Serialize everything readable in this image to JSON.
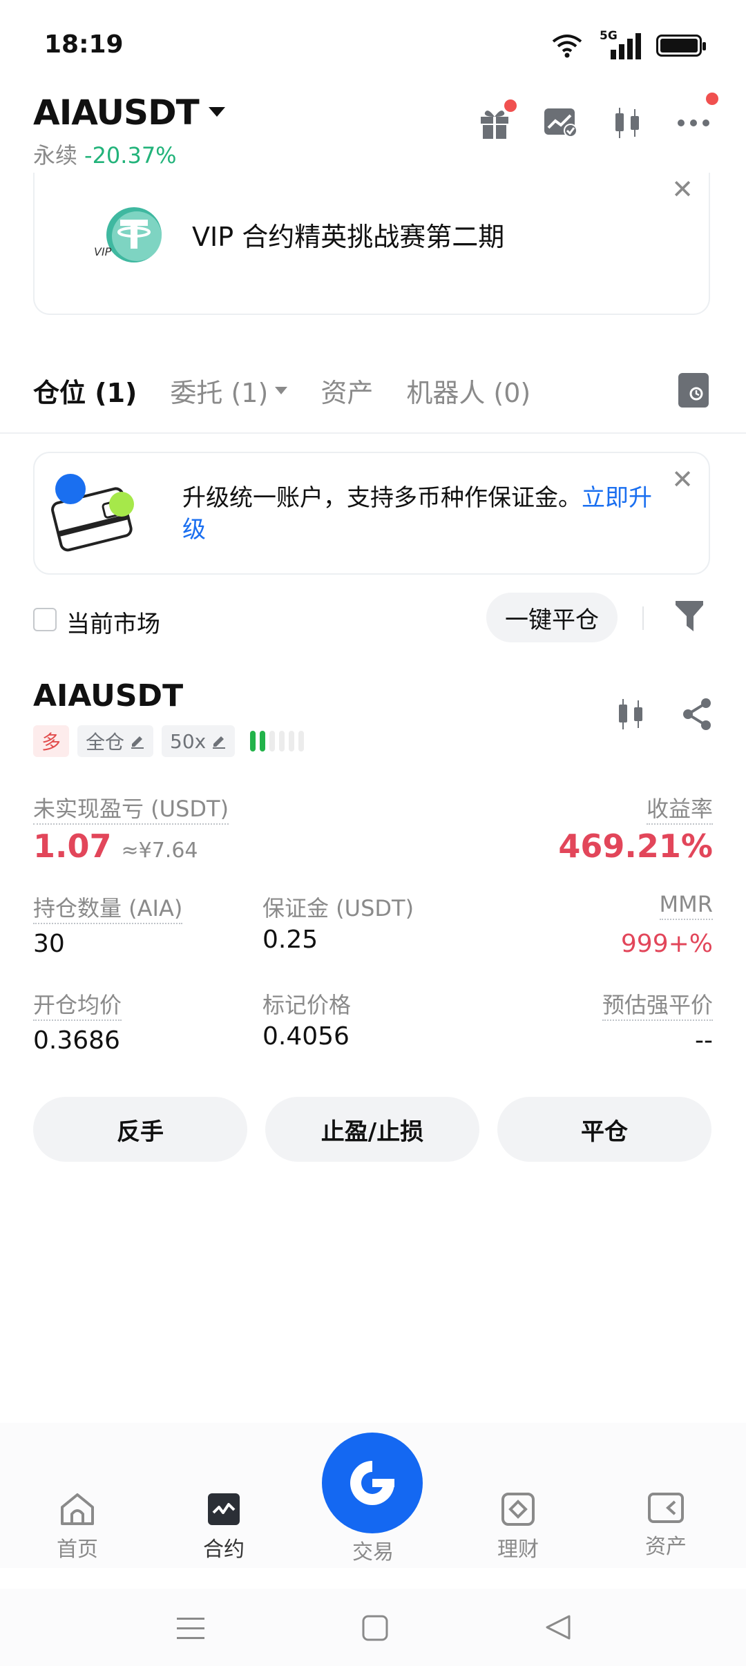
{
  "status": {
    "time": "18:19",
    "network": "5G"
  },
  "header": {
    "pair": "AIAUSDT",
    "type": "永续",
    "change": "-20.37%"
  },
  "vip_banner": {
    "text": "VIP 合约精英挑战赛第二期"
  },
  "tabs": [
    {
      "label": "仓位 (1)"
    },
    {
      "label": "委托 (1)"
    },
    {
      "label": "资产"
    },
    {
      "label": "机器人 (0)"
    }
  ],
  "upgrade_banner": {
    "text": "升级统一账户，支持多币种作保证金。",
    "link": "立即升级"
  },
  "filter": {
    "current_market_label": "当前市场",
    "close_all_label": "一键平仓"
  },
  "position": {
    "symbol": "AIAUSDT",
    "side": "多",
    "margin_mode": "全仓",
    "leverage": "50x",
    "unrealized_pnl_label": "未实现盈亏 (USDT)",
    "unrealized_pnl": "1.07",
    "unrealized_pnl_cny": "≈¥7.64",
    "roe_label": "收益率",
    "roe": "469.21%",
    "size_label": "持仓数量 (AIA)",
    "size": "30",
    "margin_label": "保证金 (USDT)",
    "margin": "0.25",
    "mmr_label": "MMR",
    "mmr": "999+%",
    "entry_label": "开仓均价",
    "entry": "0.3686",
    "mark_label": "标记价格",
    "mark": "0.4056",
    "liq_label": "预估强平价",
    "liq": "--",
    "risk_level": 0.33
  },
  "actions": {
    "reverse": "反手",
    "tpsl": "止盈/止损",
    "close": "平仓"
  },
  "nav": [
    {
      "label": "首页",
      "icon": "home-icon"
    },
    {
      "label": "合约",
      "icon": "futures-icon"
    },
    {
      "label": "交易",
      "icon": "trade-icon"
    },
    {
      "label": "理财",
      "icon": "earn-icon"
    },
    {
      "label": "资产",
      "icon": "wallet-icon"
    }
  ],
  "colors": {
    "accent": "#1468f2",
    "up": "#22b37a",
    "down": "#e2465a"
  }
}
